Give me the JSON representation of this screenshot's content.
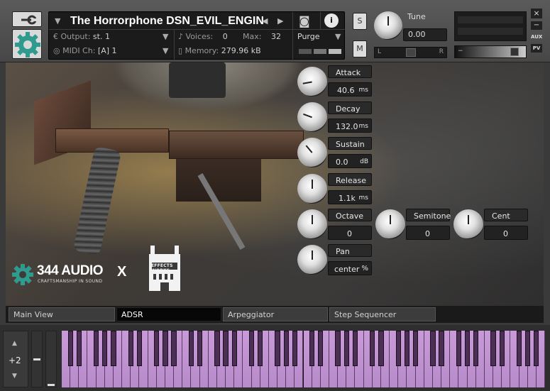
{
  "header": {
    "instrument_title": "The Horrorphone DSN_EVIL_ENGIN",
    "output_label": "Output:",
    "output_value": "st. 1",
    "voices_label": "Voices:",
    "voices_value": "0",
    "max_label": "Max:",
    "max_value": "32",
    "purge_label": "Purge",
    "midi_label": "MIDI Ch:",
    "midi_value": "[A]  1",
    "memory_label": "Memory:",
    "memory_value": "279.96 kB",
    "s_label": "S",
    "m_label": "M",
    "tune_label": "Tune",
    "tune_value": "0.00",
    "pan_left": "L",
    "pan_right": "R",
    "aux_label": "AUX",
    "pv_label": "PV",
    "close_glyph": "×",
    "minimize_glyph": "−"
  },
  "controls": {
    "attack": {
      "label": "Attack",
      "value": "40.6",
      "unit": "ms"
    },
    "decay": {
      "label": "Decay",
      "value": "132.0",
      "unit": "ms"
    },
    "sustain": {
      "label": "Sustain",
      "value": "0.0",
      "unit": "dB"
    },
    "release": {
      "label": "Release",
      "value": "1.1k",
      "unit": "ms"
    },
    "octave": {
      "label": "Octave",
      "value": "0"
    },
    "semitone": {
      "label": "Semitone",
      "value": "0"
    },
    "cent": {
      "label": "Cent",
      "value": "0"
    },
    "pan": {
      "label": "Pan",
      "value": "center",
      "unit": "%"
    }
  },
  "branding": {
    "brand_name": "344 AUDIO",
    "brand_tagline": "CRAFTSMANSHIP IN SOUND",
    "cross": "X",
    "partner_logo_text": "EFFECTS WORKS"
  },
  "tabs": [
    "Main View",
    "ADSR",
    "Arpeggiator",
    "Step Sequencer"
  ],
  "active_tab": "ADSR",
  "keyboard": {
    "octave_shift": "+2",
    "key_color": "#c89ad8",
    "black_key_color": "#4b2f55"
  }
}
